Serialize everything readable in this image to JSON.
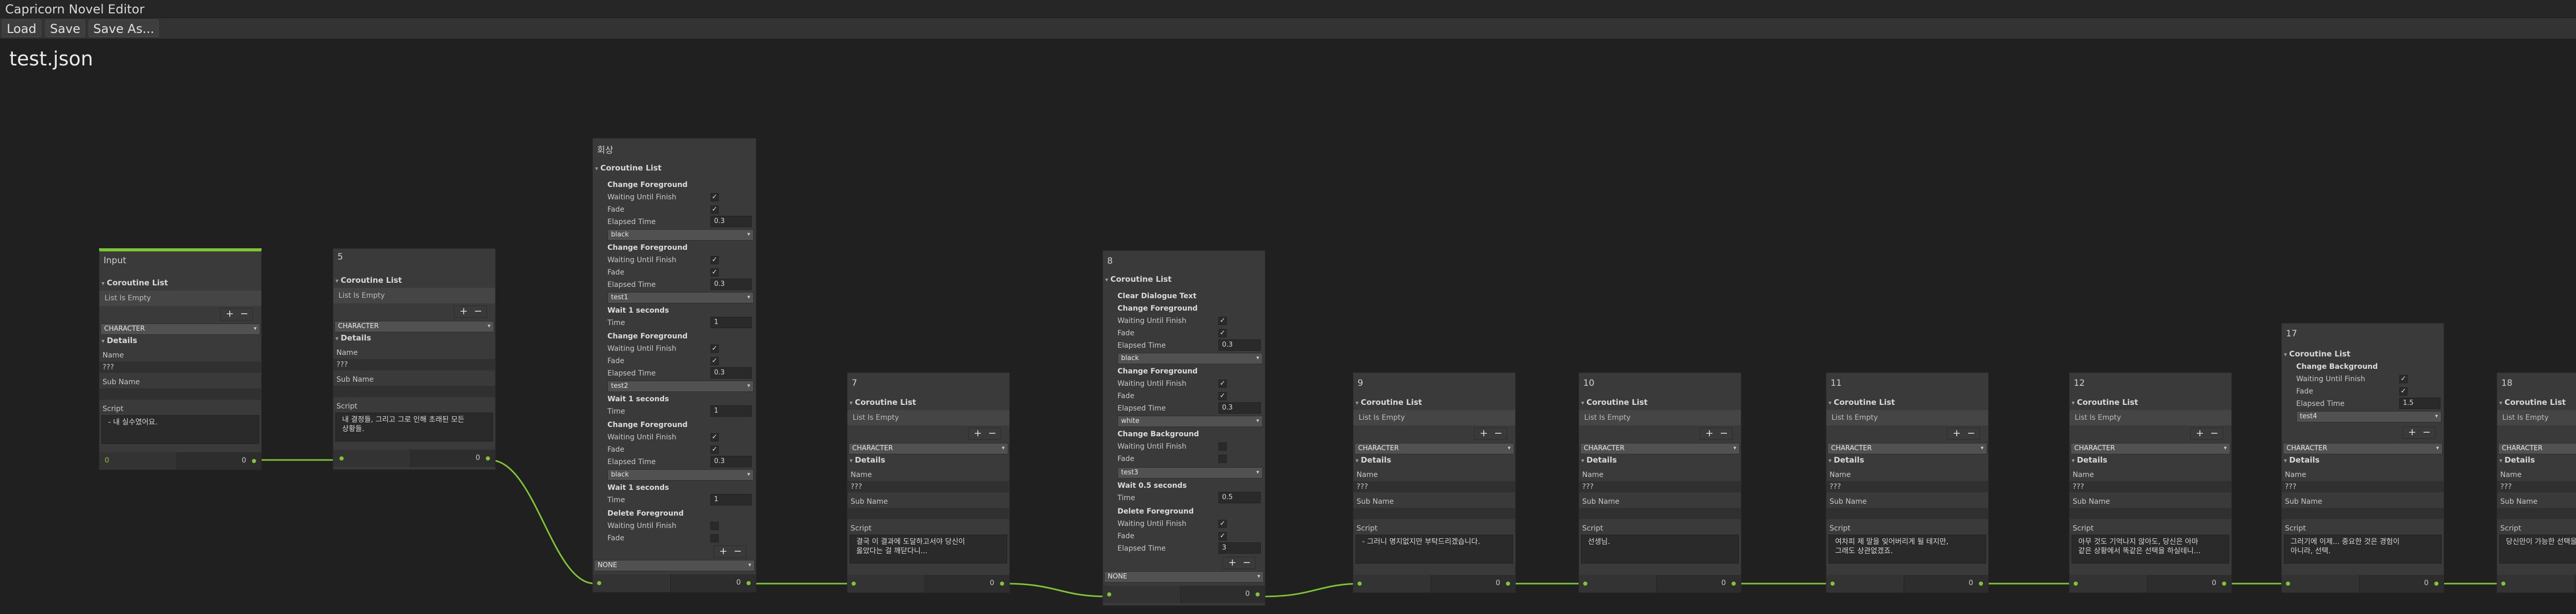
{
  "app": {
    "title": "Capricorn Novel Editor",
    "menu_icon": "more-vertical-icon"
  },
  "toolbar": {
    "load": "Load",
    "save": "Save",
    "save_as": "Save As..."
  },
  "file_name": "test.json",
  "common": {
    "coroutine_list": "Coroutine List",
    "list_is_empty": "List Is Empty",
    "character": "CHARACTER",
    "details": "Details",
    "name": "Name",
    "sub_name": "Sub Name",
    "script": "Script",
    "name_value": "???",
    "none": "NONE",
    "plus": "+",
    "minus": "−",
    "check": "✓",
    "port_count": "0",
    "dd_arrow": "▾"
  },
  "labels": {
    "change_foreground": "Change Foreground",
    "change_background": "Change Background",
    "waiting_until_finish": "Waiting Until Finish",
    "fade": "Fade",
    "elapsed_time": "Elapsed Time",
    "wait_1_seconds": "Wait 1 seconds",
    "wait_05_seconds": "Wait 0.5 seconds",
    "time": "Time",
    "delete_foreground": "Delete Foreground",
    "clear_dialogue_text": "Clear Dialogue Text"
  },
  "nodes": {
    "input": {
      "title": "Input",
      "script": "- 내 실수였어요.",
      "left_value": "0"
    },
    "n5": {
      "title": "5",
      "script_line1": "내 결정들, 그리고 그로 인해 초래된 모든",
      "script_line2": "상황들."
    },
    "n_memory": {
      "title": "회상",
      "v_ef1": "0.3",
      "v_dd1": "black",
      "v_ef2": "0.3",
      "v_dd2": "test1",
      "v_time1": "1",
      "v_ef3": "0.3",
      "v_dd3": "test2",
      "v_time2": "1",
      "v_ef4": "0.3",
      "v_dd4": "black",
      "v_time3": "1"
    },
    "n7": {
      "title": "7",
      "script_line1": "결국 이 결과에 도달하고서야 당신이",
      "script_line2": "옳았다는 걸 깨닫다니..."
    },
    "n8": {
      "title": "8",
      "v_ef1": "0.3",
      "v_dd1": "black",
      "v_ef2": "0.3",
      "v_dd2": "white",
      "v_dd3": "test3",
      "v_time1": "0.5",
      "v_ef3": "3"
    },
    "n9": {
      "title": "9",
      "script_line1": "- 그러니 명지없지만 부탁드리겠습니다."
    },
    "n10": {
      "title": "10",
      "script_line1": "선생님."
    },
    "n11": {
      "title": "11",
      "script_line1": "여차피 제 말을 잊어버리게 될 테지만,",
      "script_line2": "그래도 상관없겠죠."
    },
    "n12": {
      "title": "12",
      "script_line1": "아무 것도 기억나지 않아도, 당신은 아마",
      "script_line2": "같은 상황에서 똑같은 선택을 하실테니..."
    },
    "n17": {
      "title": "17",
      "v_ef1": "1.5",
      "v_dd1": "test4",
      "script_line1": "그러기에 이제... 중요한 것은 경험이",
      "script_line2": "아니라, 선택."
    },
    "n18": {
      "title": "18",
      "script_line1": "당신만이 가능한 선택을."
    }
  },
  "colors": {
    "wire": "#7fc637",
    "background": "#202020",
    "node": "#3a3a3a"
  }
}
